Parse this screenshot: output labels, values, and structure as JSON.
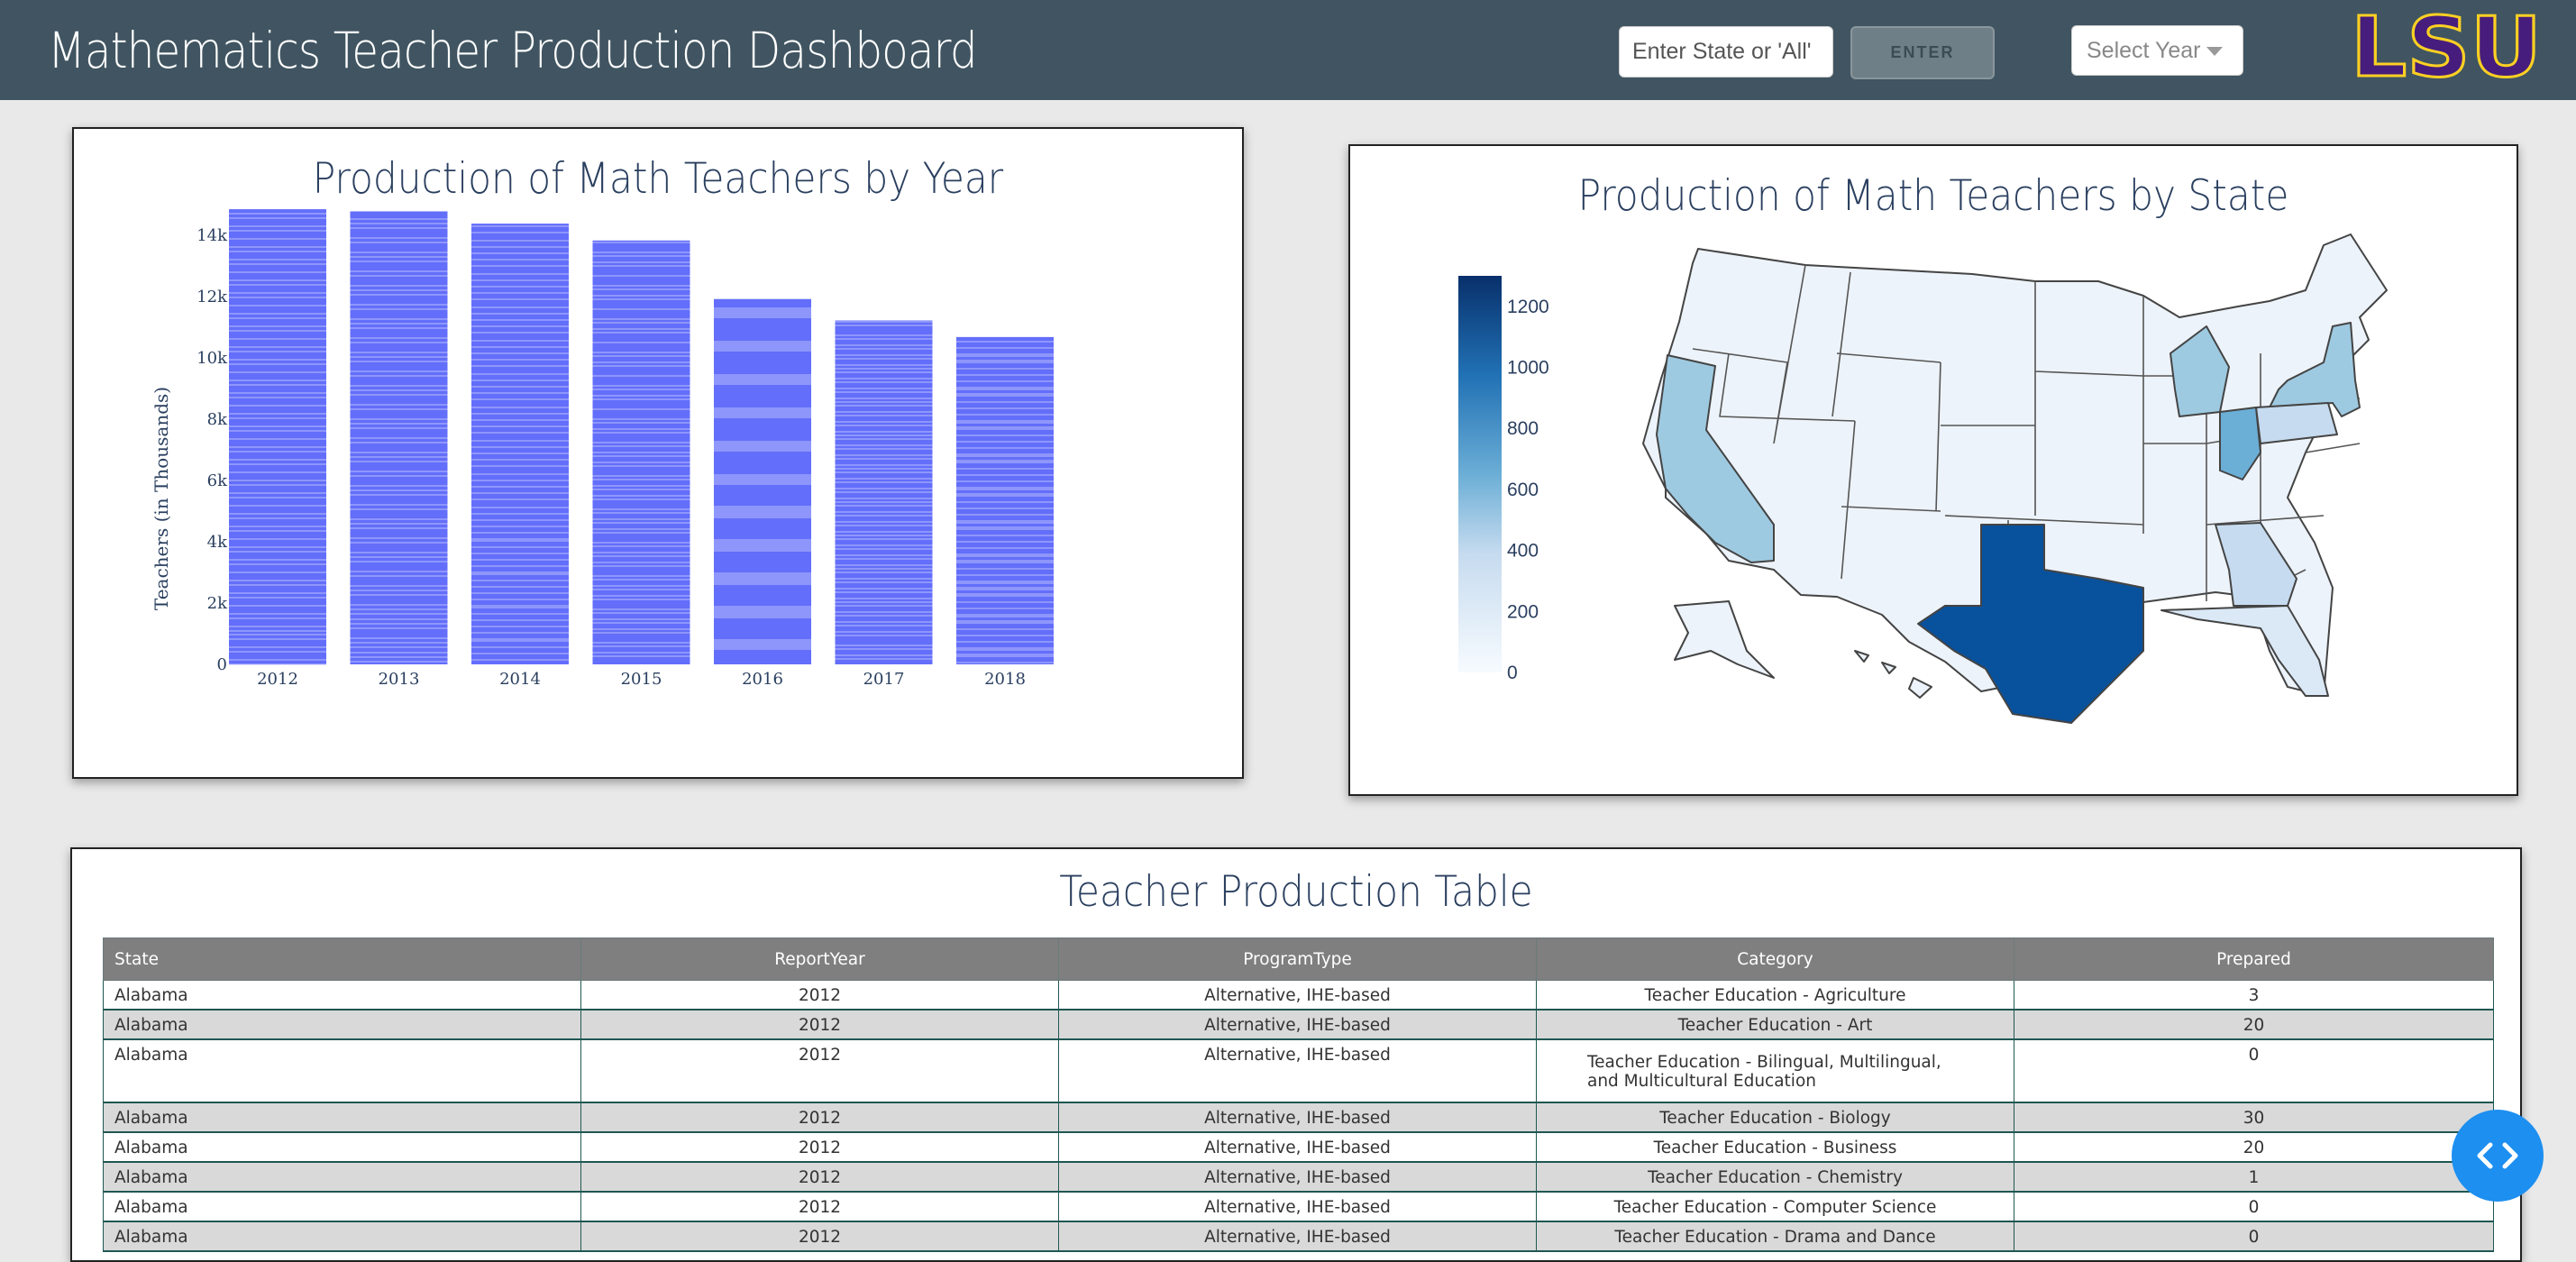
{
  "header": {
    "title": "Mathematics Teacher Production Dashboard",
    "state_placeholder": "Enter State or 'All'",
    "enter_label": "ENTER",
    "year_placeholder": "Select Year",
    "logo_text": "LSU",
    "colors": {
      "bar": "#405561",
      "logo_fill": "#461d7c",
      "logo_outline": "#fdd023"
    }
  },
  "bar_chart": {
    "title": "Production of Math Teachers by Year"
  },
  "chart_data": [
    {
      "type": "bar",
      "title": "Production of Math Teachers by Year",
      "ylabel": "Teachers (in Thousands)",
      "categories": [
        "2012",
        "2013",
        "2014",
        "2015",
        "2016",
        "2017",
        "2018"
      ],
      "values": [
        14850,
        14780,
        14380,
        13830,
        11920,
        11220,
        10680
      ],
      "yticks": [
        "0",
        "2k",
        "4k",
        "6k",
        "8k",
        "10k",
        "12k",
        "14k"
      ],
      "ylim": [
        0,
        15000
      ],
      "bar_color": "#636efa",
      "grid": false
    }
  ],
  "map_chart": {
    "title": "Production of Math Teachers by State",
    "colorbar_ticks": [
      "0",
      "200",
      "400",
      "600",
      "800",
      "1000",
      "1200"
    ],
    "colorbar_max": 1300,
    "colorscale": [
      "#f7fbff",
      "#c6dbef",
      "#6baed6",
      "#2171b5",
      "#08306b"
    ],
    "highlight": {
      "Texas": 1150,
      "California": 520,
      "New York": 520,
      "Ohio": 480,
      "Michigan": 430
    }
  },
  "table": {
    "title": "Teacher Production Table",
    "columns": [
      "State",
      "ReportYear",
      "ProgramType",
      "Category",
      "Prepared"
    ],
    "rows": [
      [
        "Alabama",
        "2012",
        "Alternative, IHE-based",
        "Teacher Education - Agriculture",
        "3"
      ],
      [
        "Alabama",
        "2012",
        "Alternative, IHE-based",
        "Teacher Education - Art",
        "20"
      ],
      [
        "Alabama",
        "2012",
        "Alternative, IHE-based",
        "Teacher Education - Bilingual, Multilingual, and Multicultural Education",
        "0"
      ],
      [
        "Alabama",
        "2012",
        "Alternative, IHE-based",
        "Teacher Education - Biology",
        "30"
      ],
      [
        "Alabama",
        "2012",
        "Alternative, IHE-based",
        "Teacher Education - Business",
        "20"
      ],
      [
        "Alabama",
        "2012",
        "Alternative, IHE-based",
        "Teacher Education - Chemistry",
        "1"
      ],
      [
        "Alabama",
        "2012",
        "Alternative, IHE-based",
        "Teacher Education - Computer Science",
        "0"
      ],
      [
        "Alabama",
        "2012",
        "Alternative, IHE-based",
        "Teacher Education - Drama and Dance",
        "0"
      ]
    ]
  },
  "fab": {
    "icon": "code-icon",
    "color": "#1d8ff0"
  }
}
